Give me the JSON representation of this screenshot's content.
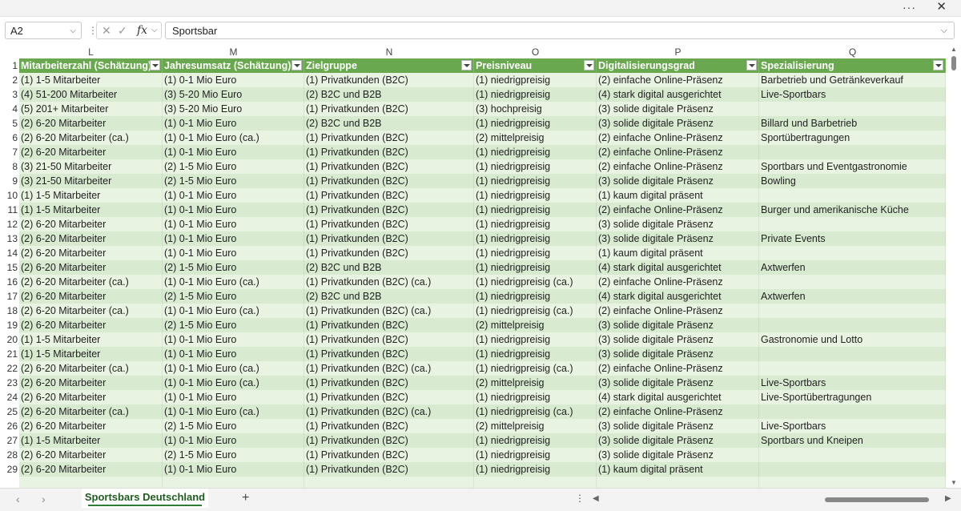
{
  "window": {
    "more_label": "···",
    "close_label": "✕"
  },
  "formula_bar": {
    "name_box": "A2",
    "cancel_icon": "✕",
    "confirm_icon": "✓",
    "fx_label": "fx",
    "value": "Sportsbar"
  },
  "columns": [
    {
      "letter": "L",
      "header": "Mitarbeiterzahl (Schätzung)"
    },
    {
      "letter": "M",
      "header": "Jahresumsatz (Schätzung)"
    },
    {
      "letter": "N",
      "header": "Zielgruppe"
    },
    {
      "letter": "O",
      "header": "Preisniveau"
    },
    {
      "letter": "P",
      "header": "Digitalisierungsgrad"
    },
    {
      "letter": "Q",
      "header": "Spezialisierung"
    }
  ],
  "rows": [
    {
      "num": "2",
      "cells": [
        "(1) 1-5 Mitarbeiter",
        "(1) 0-1 Mio Euro",
        "(1) Privatkunden (B2C)",
        "(1) niedrigpreisig",
        "(2) einfache Online-Präsenz",
        "Barbetrieb und Getränkeverkauf"
      ]
    },
    {
      "num": "3",
      "cells": [
        "(4) 51-200 Mitarbeiter",
        "(3) 5-20 Mio Euro",
        "(2) B2C und B2B",
        "(1) niedrigpreisig",
        "(4) stark digital ausgerichtet",
        "Live-Sportbars"
      ]
    },
    {
      "num": "4",
      "cells": [
        "(5) 201+ Mitarbeiter",
        "(3) 5-20 Mio Euro",
        "(1) Privatkunden (B2C)",
        "(3) hochpreisig",
        "(3) solide digitale Präsenz",
        ""
      ]
    },
    {
      "num": "5",
      "cells": [
        "(2) 6-20 Mitarbeiter",
        "(1) 0-1 Mio Euro",
        "(2) B2C und B2B",
        "(1) niedrigpreisig",
        "(3) solide digitale Präsenz",
        "Billard und Barbetrieb"
      ]
    },
    {
      "num": "6",
      "cells": [
        "(2) 6-20 Mitarbeiter (ca.)",
        "(1) 0-1 Mio Euro (ca.)",
        "(1) Privatkunden (B2C)",
        "(2) mittelpreisig",
        "(2) einfache Online-Präsenz",
        "Sportübertragungen"
      ]
    },
    {
      "num": "7",
      "cells": [
        "(2) 6-20 Mitarbeiter",
        "(1) 0-1 Mio Euro",
        "(1) Privatkunden (B2C)",
        "(1) niedrigpreisig",
        "(2) einfache Online-Präsenz",
        ""
      ]
    },
    {
      "num": "8",
      "cells": [
        "(3) 21-50 Mitarbeiter",
        "(2) 1-5 Mio Euro",
        "(1) Privatkunden (B2C)",
        "(1) niedrigpreisig",
        "(2) einfache Online-Präsenz",
        "Sportbars und Eventgastronomie"
      ]
    },
    {
      "num": "9",
      "cells": [
        "(3) 21-50 Mitarbeiter",
        "(2) 1-5 Mio Euro",
        "(1) Privatkunden (B2C)",
        "(1) niedrigpreisig",
        "(3) solide digitale Präsenz",
        "Bowling"
      ]
    },
    {
      "num": "10",
      "cells": [
        "(1) 1-5 Mitarbeiter",
        "(1) 0-1 Mio Euro",
        "(1) Privatkunden (B2C)",
        "(1) niedrigpreisig",
        "(1) kaum digital präsent",
        ""
      ]
    },
    {
      "num": "11",
      "cells": [
        "(1) 1-5 Mitarbeiter",
        "(1) 0-1 Mio Euro",
        "(1) Privatkunden (B2C)",
        "(1) niedrigpreisig",
        "(2) einfache Online-Präsenz",
        "Burger und amerikanische Küche"
      ]
    },
    {
      "num": "12",
      "cells": [
        "(2) 6-20 Mitarbeiter",
        "(1) 0-1 Mio Euro",
        "(1) Privatkunden (B2C)",
        "(1) niedrigpreisig",
        "(3) solide digitale Präsenz",
        ""
      ]
    },
    {
      "num": "13",
      "cells": [
        "(2) 6-20 Mitarbeiter",
        "(1) 0-1 Mio Euro",
        "(1) Privatkunden (B2C)",
        "(1) niedrigpreisig",
        "(3) solide digitale Präsenz",
        "Private Events"
      ]
    },
    {
      "num": "14",
      "cells": [
        "(2) 6-20 Mitarbeiter",
        "(1) 0-1 Mio Euro",
        "(1) Privatkunden (B2C)",
        "(1) niedrigpreisig",
        "(1) kaum digital präsent",
        ""
      ]
    },
    {
      "num": "15",
      "cells": [
        "(2) 6-20 Mitarbeiter",
        "(2) 1-5 Mio Euro",
        "(2) B2C und B2B",
        "(1) niedrigpreisig",
        "(4) stark digital ausgerichtet",
        "Axtwerfen"
      ]
    },
    {
      "num": "16",
      "cells": [
        "(2) 6-20 Mitarbeiter (ca.)",
        "(1) 0-1 Mio Euro (ca.)",
        "(1) Privatkunden (B2C) (ca.)",
        "(1) niedrigpreisig (ca.)",
        "(2) einfache Online-Präsenz",
        ""
      ]
    },
    {
      "num": "17",
      "cells": [
        "(2) 6-20 Mitarbeiter",
        "(2) 1-5 Mio Euro",
        "(2) B2C und B2B",
        "(1) niedrigpreisig",
        "(4) stark digital ausgerichtet",
        "Axtwerfen"
      ]
    },
    {
      "num": "18",
      "cells": [
        "(2) 6-20 Mitarbeiter (ca.)",
        "(1) 0-1 Mio Euro (ca.)",
        "(1) Privatkunden (B2C) (ca.)",
        "(1) niedrigpreisig (ca.)",
        "(2) einfache Online-Präsenz",
        ""
      ]
    },
    {
      "num": "19",
      "cells": [
        "(2) 6-20 Mitarbeiter",
        "(2) 1-5 Mio Euro",
        "(1) Privatkunden (B2C)",
        "(2) mittelpreisig",
        "(3) solide digitale Präsenz",
        ""
      ]
    },
    {
      "num": "20",
      "cells": [
        "(1) 1-5 Mitarbeiter",
        "(1) 0-1 Mio Euro",
        "(1) Privatkunden (B2C)",
        "(1) niedrigpreisig",
        "(3) solide digitale Präsenz",
        "Gastronomie und Lotto"
      ]
    },
    {
      "num": "21",
      "cells": [
        "(1) 1-5 Mitarbeiter",
        "(1) 0-1 Mio Euro",
        "(1) Privatkunden (B2C)",
        "(1) niedrigpreisig",
        "(3) solide digitale Präsenz",
        ""
      ]
    },
    {
      "num": "22",
      "cells": [
        "(2) 6-20 Mitarbeiter (ca.)",
        "(1) 0-1 Mio Euro (ca.)",
        "(1) Privatkunden (B2C) (ca.)",
        "(1) niedrigpreisig (ca.)",
        "(2) einfache Online-Präsenz",
        ""
      ]
    },
    {
      "num": "23",
      "cells": [
        "(2) 6-20 Mitarbeiter",
        "(1) 0-1 Mio Euro (ca.)",
        "(1) Privatkunden (B2C)",
        "(2) mittelpreisig",
        "(3) solide digitale Präsenz",
        "Live-Sportbars"
      ]
    },
    {
      "num": "24",
      "cells": [
        "(2) 6-20 Mitarbeiter",
        "(1) 0-1 Mio Euro",
        "(1) Privatkunden (B2C)",
        "(1) niedrigpreisig",
        "(4) stark digital ausgerichtet",
        "Live-Sportübertragungen"
      ]
    },
    {
      "num": "25",
      "cells": [
        "(2) 6-20 Mitarbeiter (ca.)",
        "(1) 0-1 Mio Euro (ca.)",
        "(1) Privatkunden (B2C) (ca.)",
        "(1) niedrigpreisig (ca.)",
        "(2) einfache Online-Präsenz",
        ""
      ]
    },
    {
      "num": "26",
      "cells": [
        "(2) 6-20 Mitarbeiter",
        "(2) 1-5 Mio Euro",
        "(1) Privatkunden (B2C)",
        "(2) mittelpreisig",
        "(3) solide digitale Präsenz",
        "Live-Sportbars"
      ]
    },
    {
      "num": "27",
      "cells": [
        "(1) 1-5 Mitarbeiter",
        "(1) 0-1 Mio Euro",
        "(1) Privatkunden (B2C)",
        "(1) niedrigpreisig",
        "(3) solide digitale Präsenz",
        "Sportbars und Kneipen"
      ]
    },
    {
      "num": "28",
      "cells": [
        "(2) 6-20 Mitarbeiter",
        "(2) 1-5 Mio Euro",
        "(1) Privatkunden (B2C)",
        "(1) niedrigpreisig",
        "(3) solide digitale Präsenz",
        ""
      ]
    },
    {
      "num": "29",
      "cells": [
        "(2) 6-20 Mitarbeiter",
        "(1) 0-1 Mio Euro",
        "(1) Privatkunden (B2C)",
        "(1) niedrigpreisig",
        "(1) kaum digital präsent",
        ""
      ]
    }
  ],
  "sheet_tabs": [
    {
      "label": "Sportsbars Deutschland",
      "active": true
    }
  ],
  "add_sheet_label": "+",
  "colors": {
    "header_fill": "#6aa84f",
    "band_light": "#e8f3e1",
    "band_dark": "#d8ead0",
    "active_tab": "#2e7d32"
  }
}
